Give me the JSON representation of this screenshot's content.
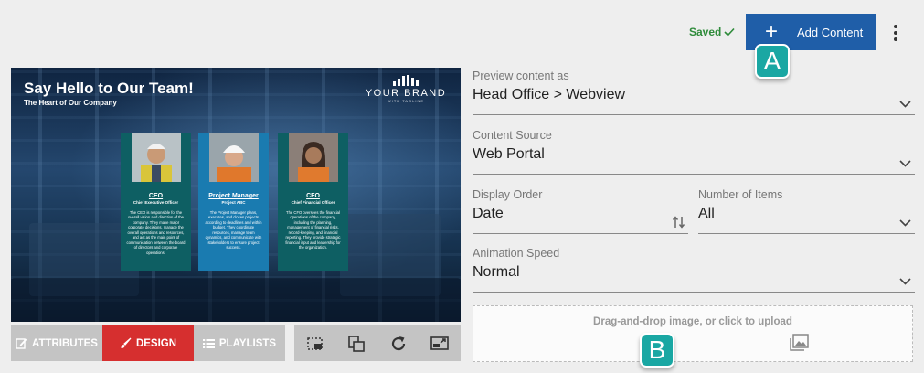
{
  "header": {
    "saved_label": "Saved",
    "add_content_label": "Add Content",
    "accent_color": "#1f5ea8"
  },
  "callouts": {
    "a": "A",
    "b": "B"
  },
  "preview": {
    "title": "Say Hello to Our Team!",
    "subtitle": "The Heart of Our Company",
    "brand_name": "YOUR BRAND",
    "brand_tagline": "WITH TAGLINE",
    "cards": [
      {
        "name": "CEO",
        "role": "Chief Executive Officer",
        "description": "The CEO is responsible for the overall vision and direction of the company. They make major corporate decisions, manage the overall operations and resources, and act as the main point of communication between the board of directors and corporate operations."
      },
      {
        "name": "Project Manager",
        "role": "Project ABC",
        "description": "The Project Manager plans, executes, and closes projects according to deadlines and within budget. They coordinate resources, manage team dynamics, and communicate with stakeholders to ensure project success."
      },
      {
        "name": "CFO",
        "role": "Chief Financial Officer",
        "description": "The CFO oversees the financial operations of the company, including the planning, management of financial risks, record-keeping, and financial reporting. They provide strategic financial input and leadership for the organization."
      }
    ]
  },
  "tabs": {
    "attributes": "ATTRIBUTES",
    "design": "DESIGN",
    "playlists": "PLAYLISTS",
    "active_color": "#d62f2f"
  },
  "form": {
    "preview_as": {
      "label": "Preview content as",
      "value": "Head Office > Webview"
    },
    "content_source": {
      "label": "Content Source",
      "value": "Web Portal"
    },
    "display_order": {
      "label": "Display Order",
      "value": "Date"
    },
    "number_of_items": {
      "label": "Number of Items",
      "value": "All"
    },
    "animation_speed": {
      "label": "Animation Speed",
      "value": "Normal"
    }
  },
  "dropzone": {
    "text": "Drag-and-drop image, or click to upload"
  }
}
